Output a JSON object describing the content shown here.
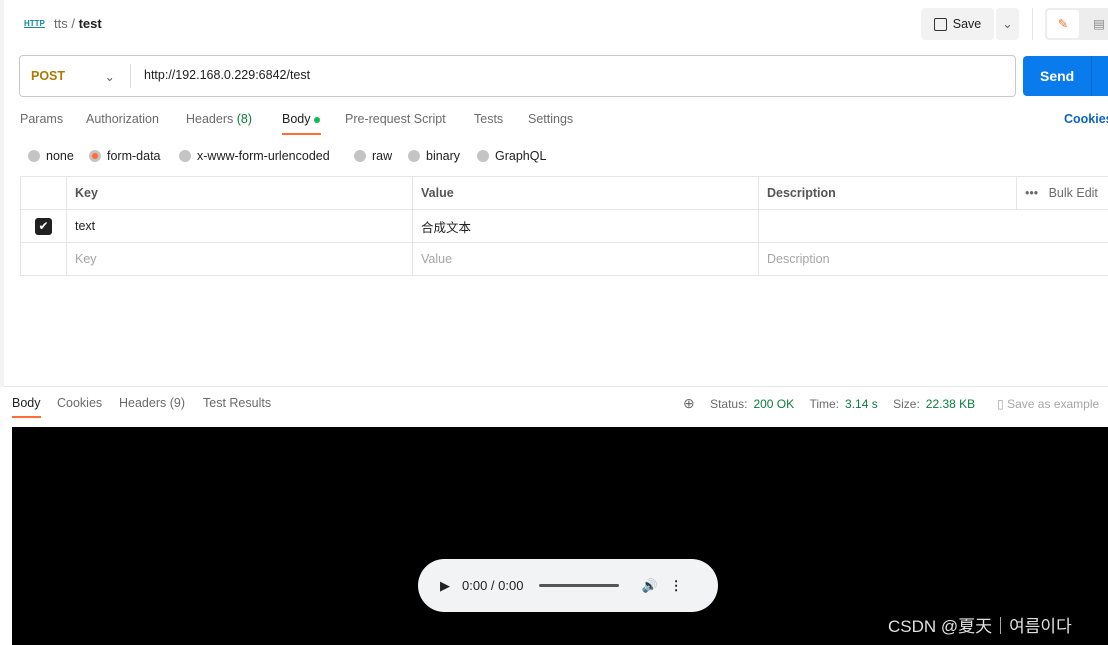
{
  "breadcrumb": {
    "collection": "tts",
    "request": "test",
    "icon": "http-icon"
  },
  "toolbar": {
    "save_label": "Save"
  },
  "request": {
    "method": "POST",
    "url": "http://192.168.0.229:6842/test",
    "send_label": "Send"
  },
  "tabs": [
    {
      "label": "Params"
    },
    {
      "label": "Authorization"
    },
    {
      "label": "Headers",
      "count": "(8)"
    },
    {
      "label": "Body"
    },
    {
      "label": "Pre-request Script"
    },
    {
      "label": "Tests"
    },
    {
      "label": "Settings"
    }
  ],
  "cookies_label": "Cookies",
  "body_types": [
    "none",
    "form-data",
    "x-www-form-urlencoded",
    "raw",
    "binary",
    "GraphQL"
  ],
  "selected_body_type": "form-data",
  "table": {
    "headers": [
      "Key",
      "Value",
      "Description"
    ],
    "bulk_edit": "Bulk Edit",
    "rows": [
      {
        "checked": true,
        "key": "text",
        "value": "合成文本",
        "description": ""
      }
    ],
    "placeholder": {
      "key": "Key",
      "value": "Value",
      "description": "Description"
    }
  },
  "response": {
    "tabs": [
      {
        "label": "Body"
      },
      {
        "label": "Cookies"
      },
      {
        "label": "Headers (9)"
      },
      {
        "label": "Test Results"
      }
    ],
    "status_label": "Status:",
    "status": "200 OK",
    "time_label": "Time:",
    "time": "3.14 s",
    "size_label": "Size:",
    "size": "22.38 KB",
    "save_example": "Save as example"
  },
  "audio": {
    "time": "0:00 / 0:00"
  },
  "watermark": "CSDN @夏天｜여름이다",
  "colors": {
    "accent": "#ff6c37",
    "send": "#097bed",
    "method": "#ad7a03",
    "success": "#0a7d3c"
  }
}
